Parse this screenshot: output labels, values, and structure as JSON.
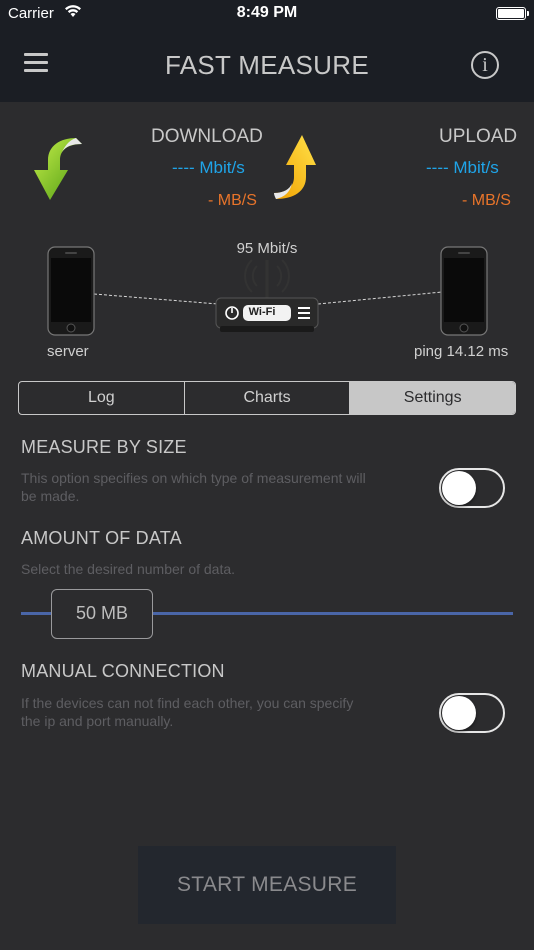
{
  "status_bar": {
    "carrier": "Carrier",
    "time": "8:49 PM"
  },
  "nav": {
    "title": "FAST MEASURE",
    "menu_icon": "hamburger-menu-icon",
    "info_icon": "info-icon"
  },
  "download": {
    "label": "DOWNLOAD",
    "mbit": "---- Mbit/s",
    "mbs": "- MB/S",
    "icon": "green-down-arrow-icon",
    "color": "#1fa4e8"
  },
  "upload": {
    "label": "UPLOAD",
    "mbit": "---- Mbit/s",
    "mbs": "- MB/S",
    "icon": "orange-up-arrow-icon",
    "color": "#e8742a"
  },
  "network": {
    "router_speed": "95 Mbit/s",
    "router_label": "Wi-Fi",
    "left_device_caption": "server",
    "right_device_caption": "ping 14.12 ms"
  },
  "tabs": [
    {
      "label": "Log",
      "active": false
    },
    {
      "label": "Charts",
      "active": false
    },
    {
      "label": "Settings",
      "active": true
    }
  ],
  "settings": {
    "measure_by_size": {
      "title": "MEASURE BY SIZE",
      "description_line1": "This option specifies on which type of measurement will",
      "description_line2": "be made.",
      "enabled": false
    },
    "amount_of_data": {
      "title": "AMOUNT OF DATA",
      "description": "Select the desired number of data.",
      "value": "50 MB",
      "accent": "#4a66a8"
    },
    "manual_connection": {
      "title": "MANUAL CONNECTION",
      "description_line1": "If the devices can not find each other, you can specify",
      "description_line2": "the ip and port manually.",
      "enabled": false
    }
  },
  "start_button": {
    "label": "START MEASURE"
  }
}
